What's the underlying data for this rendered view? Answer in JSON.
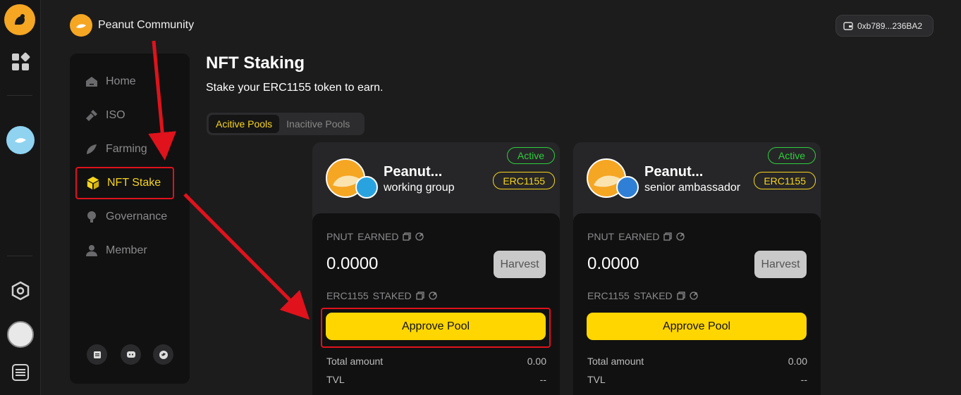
{
  "app": {
    "brand_name": "Peanut Community",
    "wallet_address": "0xb789...236BA2"
  },
  "rail": {
    "icons": [
      "squirrel-logo-icon",
      "apps-grid-icon",
      "globe-avatar-icon",
      "hexagon-icon",
      "peanut-avatar-icon",
      "list-menu-icon"
    ]
  },
  "nav": {
    "items": [
      {
        "label": "Home",
        "icon": "home-icon"
      },
      {
        "label": "ISO",
        "icon": "shovel-icon"
      },
      {
        "label": "Farming",
        "icon": "farming-icon"
      },
      {
        "label": "NFT Stake",
        "icon": "cube-icon",
        "active": true
      },
      {
        "label": "Governance",
        "icon": "bulb-icon"
      },
      {
        "label": "Member",
        "icon": "user-icon"
      }
    ],
    "social": [
      "document-icon",
      "discord-icon",
      "twitter-icon"
    ]
  },
  "page": {
    "title": "NFT Staking",
    "subtitle": "Stake your ERC1155 token to earn.",
    "tabs": [
      {
        "label": "Acitive Pools",
        "active": true
      },
      {
        "label": "Inacitive Pools"
      }
    ]
  },
  "cards": [
    {
      "name": "Peanut...",
      "group": "working group",
      "status": "Active",
      "standard": "ERC1155",
      "earned_token": "PNUT",
      "earned_label": "EARNED",
      "earned_value": "0.0000",
      "harvest_label": "Harvest",
      "staked_token": "ERC1155",
      "staked_label": "STAKED",
      "approve_label": "Approve Pool",
      "stats": [
        {
          "label": "Total amount",
          "value": "0.00"
        },
        {
          "label": "TVL",
          "value": "--"
        }
      ]
    },
    {
      "name": "Peanut...",
      "group": "senior ambassador",
      "status": "Active",
      "standard": "ERC1155",
      "earned_token": "PNUT",
      "earned_label": "EARNED",
      "earned_value": "0.0000",
      "harvest_label": "Harvest",
      "staked_token": "ERC1155",
      "staked_label": "STAKED",
      "approve_label": "Approve Pool",
      "stats": [
        {
          "label": "Total amount",
          "value": "0.00"
        },
        {
          "label": "TVL",
          "value": "--"
        }
      ]
    }
  ],
  "colors": {
    "accent": "#ffd600",
    "active_green": "#2fcf3c",
    "annotation_red": "#e0121b"
  }
}
